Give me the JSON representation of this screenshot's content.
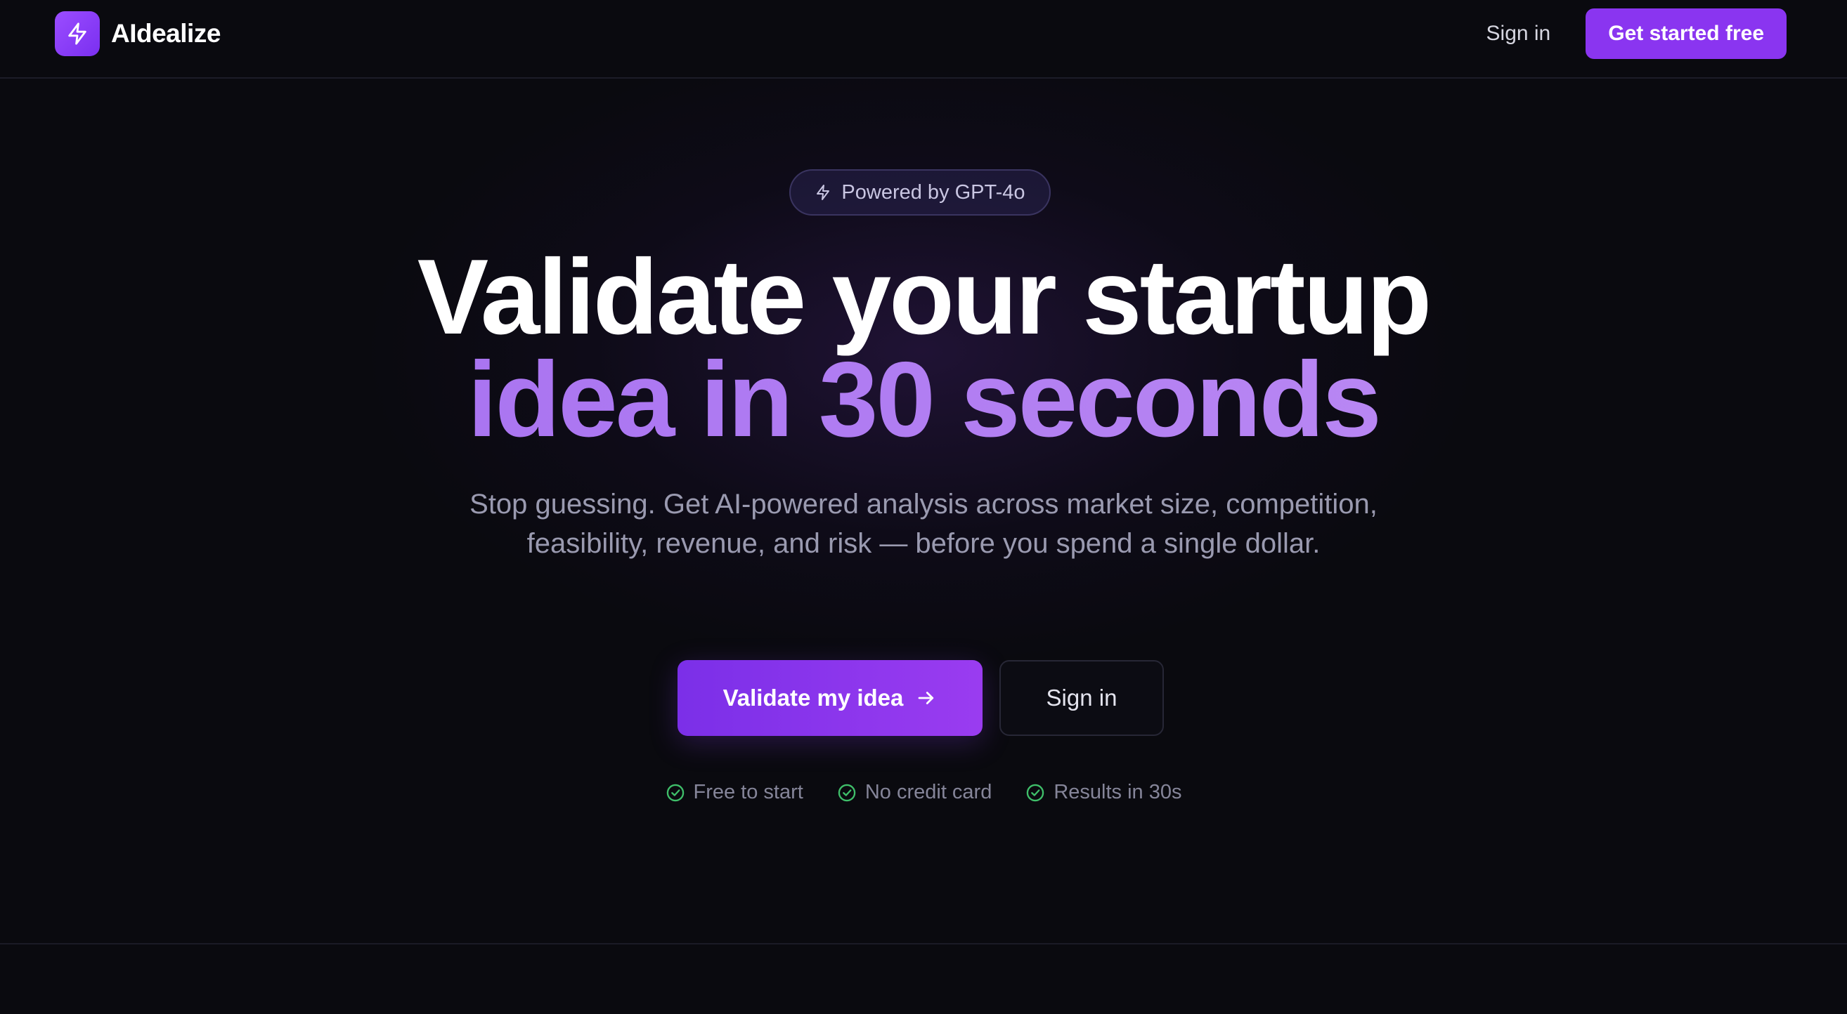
{
  "navbar": {
    "brand_name": "AIdealize",
    "brand_icon": "lightning-icon",
    "sign_in_label": "Sign in",
    "cta_label": "Get started free"
  },
  "hero": {
    "badge_icon": "lightning-icon",
    "badge_text": "Powered by GPT-4o",
    "headline_line1": "Validate your startup",
    "headline_line2": "idea in 30 seconds",
    "subtitle": "Stop guessing. Get AI-powered analysis across market size, competition, feasibility, revenue, and risk — before you spend a single dollar.",
    "primary_cta_label": "Validate my idea",
    "primary_cta_icon": "arrow-right-icon",
    "secondary_cta_label": "Sign in",
    "features": [
      {
        "icon": "check-circle-icon",
        "label": "Free to start"
      },
      {
        "icon": "check-circle-icon",
        "label": "No credit card"
      },
      {
        "icon": "check-circle-icon",
        "label": "Results in 30s"
      }
    ]
  },
  "colors": {
    "background": "#0a0a0f",
    "accent": "#8a35f0",
    "headline_gradient_start": "#a36cf0",
    "headline_gradient_end": "#bf8ff4",
    "check_green": "#3fbf6a"
  }
}
